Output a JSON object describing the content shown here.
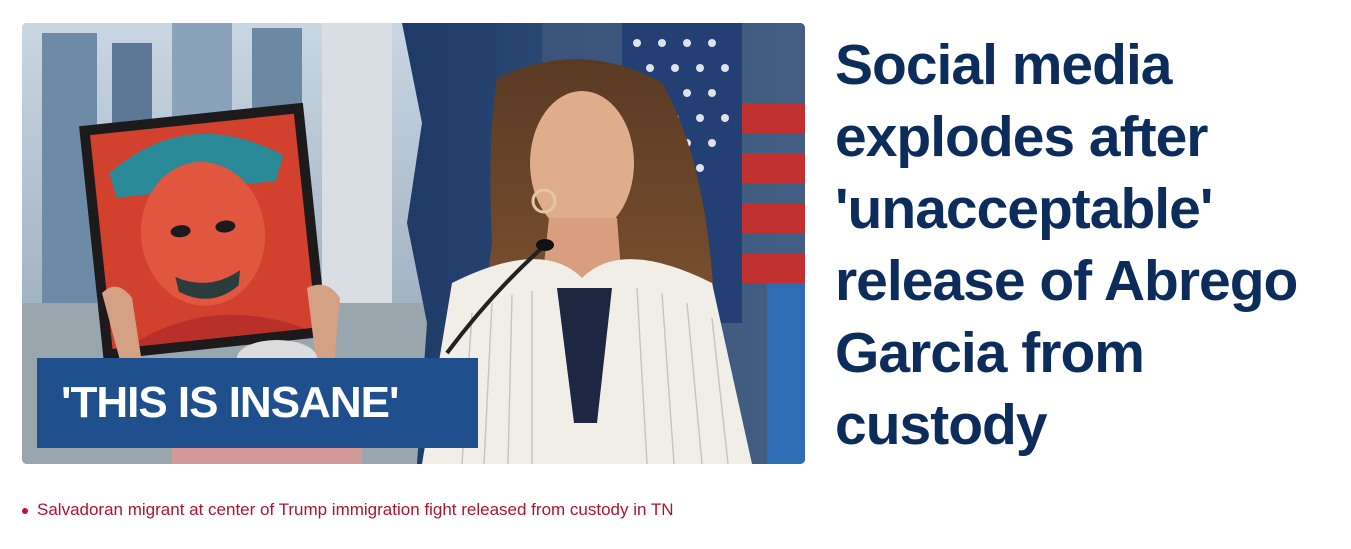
{
  "hero": {
    "image_label": "Protester holding a portrait poster of Abrego Garcia next to Kristi Noem speaking at a podium with an American flag behind her",
    "overlay_text": "'THIS IS INSANE'"
  },
  "headline": "Social media explodes after 'unacceptable' release of Abrego Garcia from custody",
  "related": [
    {
      "text": "Salvadoran migrant at center of Trump immigration fight released from custody in TN"
    }
  ],
  "colors": {
    "headline": "#0c2d5c",
    "overlay_bg": "#1f4f8d",
    "related_link": "#b2122b",
    "bullet": "#c8102e"
  }
}
